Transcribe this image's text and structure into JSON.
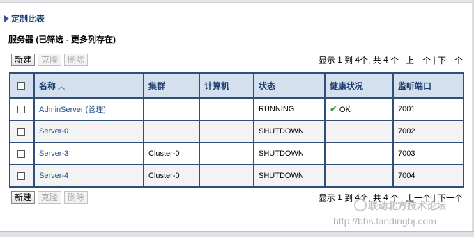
{
  "customize": {
    "label": "定制此表"
  },
  "section": {
    "title": "服务器 (已筛选 - 更多列存在)"
  },
  "toolbar": {
    "new_label": "新建",
    "clone_label": "克隆",
    "delete_label": "删除"
  },
  "pager": {
    "show": "显示 ",
    "from": "1",
    "to_word": " 到 ",
    "to": "4",
    "sep_total": "个, 共 ",
    "total": "4",
    "unit": " 个",
    "prev": "上一个",
    "divider": " | ",
    "next": "下一个"
  },
  "table": {
    "headers": [
      "名称",
      "集群",
      "计算机",
      "状态",
      "健康状况",
      "监听端口"
    ],
    "rows": [
      {
        "name": "AdminServer (管理)",
        "cluster": "",
        "machine": "",
        "state": "RUNNING",
        "health": "OK",
        "port": "7001"
      },
      {
        "name": "Server-0",
        "cluster": "",
        "machine": "",
        "state": "SHUTDOWN",
        "health": "",
        "port": "7002"
      },
      {
        "name": "Server-3",
        "cluster": "Cluster-0",
        "machine": "",
        "state": "SHUTDOWN",
        "health": "",
        "port": "7003"
      },
      {
        "name": "Server-4",
        "cluster": "Cluster-0",
        "machine": "",
        "state": "SHUTDOWN",
        "health": "",
        "port": "7004"
      }
    ]
  },
  "icons": {
    "customize": "triangle-right-icon",
    "sort": "sort-ascending-icon",
    "health_ok": "check-icon"
  },
  "watermark": {
    "text": "联动北方技术论坛",
    "url": "http://bbs.landingbj.com"
  },
  "colors": {
    "header_bg": "#d5e0ee",
    "border": "#2f4f7a",
    "link": "#1c4f8f",
    "ok": "#2c9a2c"
  }
}
